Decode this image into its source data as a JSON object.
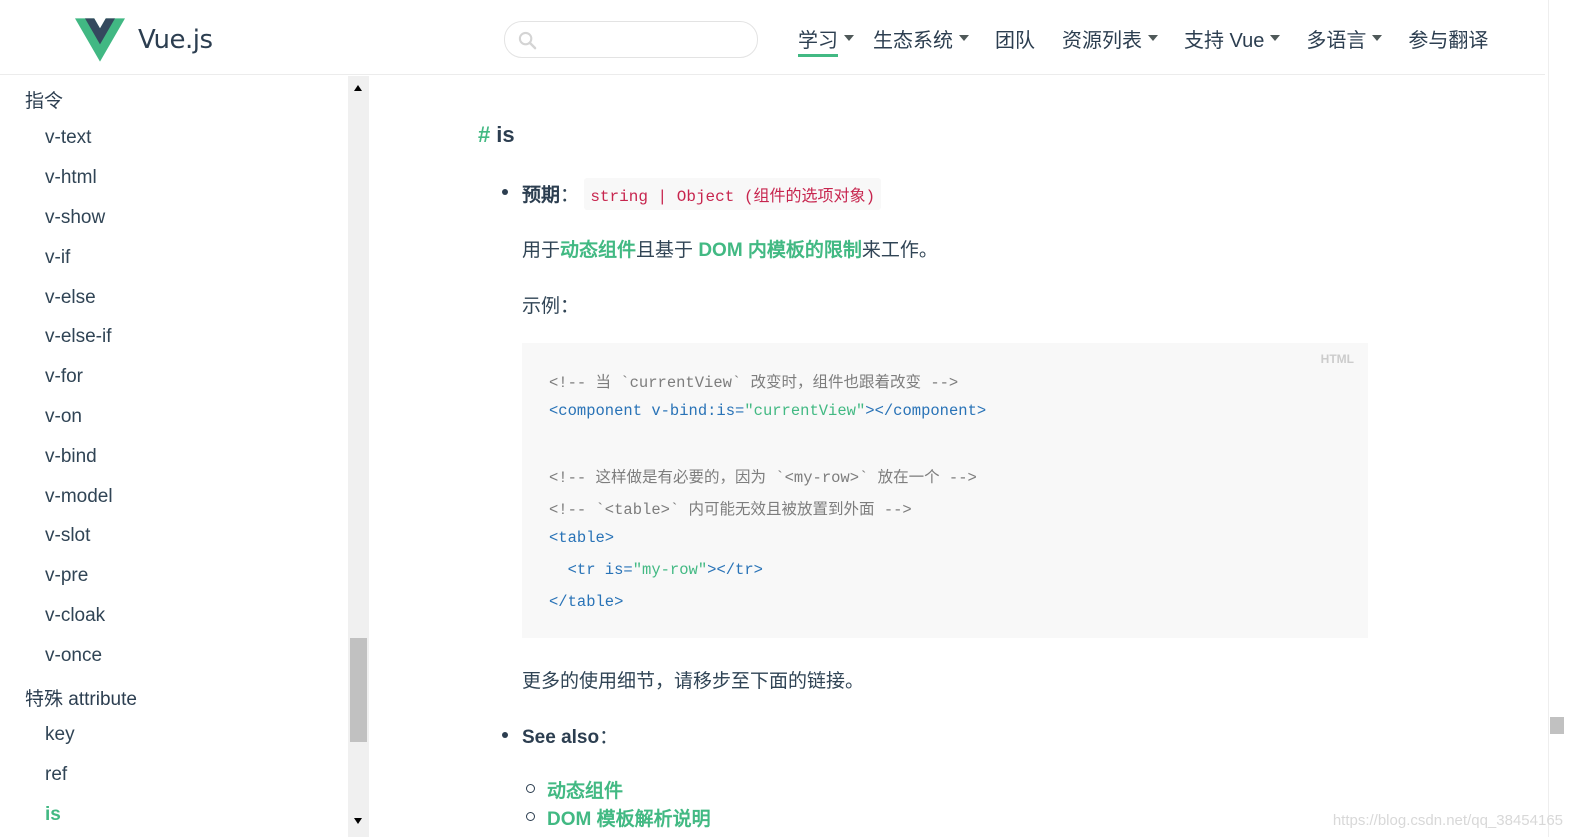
{
  "header": {
    "brand": "Vue.js",
    "search_placeholder": "",
    "nav": [
      {
        "label": "学习",
        "has_dropdown": true,
        "active": true
      },
      {
        "label": "生态系统",
        "has_dropdown": true,
        "active": false
      },
      {
        "label": "团队",
        "has_dropdown": false,
        "active": false
      },
      {
        "label": "资源列表",
        "has_dropdown": true,
        "active": false
      },
      {
        "label": "支持 Vue",
        "has_dropdown": true,
        "active": false
      },
      {
        "label": "多语言",
        "has_dropdown": true,
        "active": false
      },
      {
        "label": "参与翻译",
        "has_dropdown": false,
        "active": false
      }
    ],
    "accent_color": "#42b983"
  },
  "sidebar": {
    "sections": [
      {
        "title": "指令",
        "items": [
          "v-text",
          "v-html",
          "v-show",
          "v-if",
          "v-else",
          "v-else-if",
          "v-for",
          "v-on",
          "v-bind",
          "v-model",
          "v-slot",
          "v-pre",
          "v-cloak",
          "v-once"
        ]
      },
      {
        "title": "特殊 attribute",
        "items": [
          "key",
          "ref",
          "is"
        ]
      }
    ],
    "active_item": "is"
  },
  "content": {
    "heading_hash": "#",
    "heading": "is",
    "expected_label": "预期",
    "colon": "：",
    "expected_code": "string | Object (组件的选项对象)",
    "usage_prefix": "用于",
    "usage_link1": "动态组件",
    "usage_mid": "且基于 ",
    "usage_link2": "DOM 内模板的限制",
    "usage_suffix": "来工作。",
    "example_label": "示例：",
    "code_lang": "HTML",
    "more_details": "更多的使用细节，请移步至下面的链接。",
    "see_also_label": "See also",
    "see_also_links": [
      "动态组件",
      "DOM 模板解析说明"
    ],
    "code": {
      "l1": "<!-- 当 `currentView` 改变时，组件也跟着改变 -->",
      "l2_open": "<component v-bind:is=",
      "l2_val": "\"currentView\"",
      "l2_close": "></component>",
      "l3": "<!-- 这样做是有必要的，因为 `<my-row>` 放在一个 -->",
      "l4": "<!-- `<table>` 内可能无效且被放置到外面 -->",
      "l5": "<table>",
      "l6_open": "  <tr is=",
      "l6_val": "\"my-row\"",
      "l6_close": "></tr>",
      "l7": "</table>"
    }
  },
  "watermark": "https://blog.csdn.net/qq_38454165"
}
